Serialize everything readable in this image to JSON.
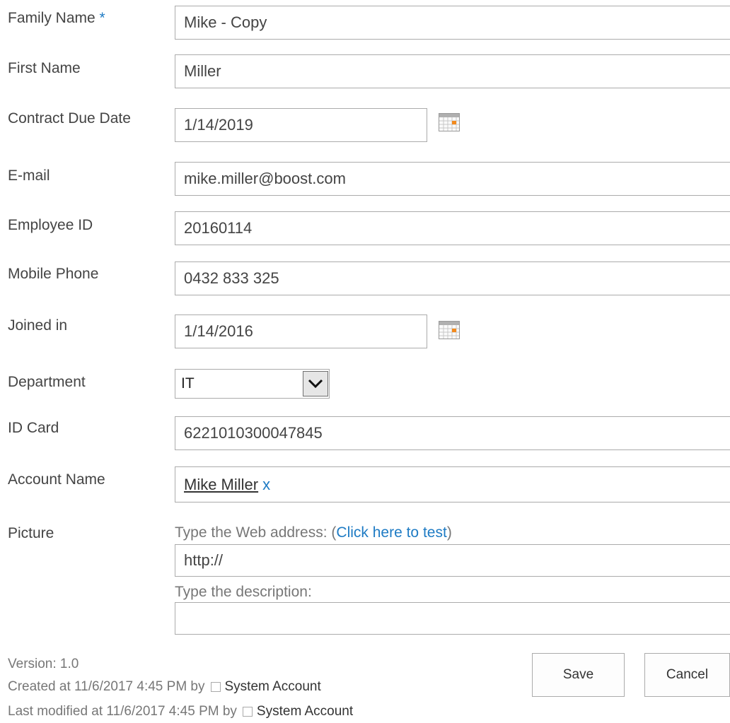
{
  "form": {
    "family_name": {
      "label": "Family Name",
      "required_marker": "*",
      "value": "Mike - Copy"
    },
    "first_name": {
      "label": "First Name",
      "value": "Miller"
    },
    "contract_due_date": {
      "label": "Contract Due Date",
      "value": "1/14/2019"
    },
    "email": {
      "label": "E-mail",
      "value": "mike.miller@boost.com"
    },
    "employee_id": {
      "label": "Employee ID",
      "value": "20160114"
    },
    "mobile_phone": {
      "label": "Mobile Phone",
      "value": "0432 833 325"
    },
    "joined_in": {
      "label": "Joined in",
      "value": "1/14/2016"
    },
    "department": {
      "label": "Department",
      "selected": "IT"
    },
    "id_card": {
      "label": "ID Card",
      "value": "6221010300047845"
    },
    "account_name": {
      "label": "Account Name",
      "person": "Mike Miller",
      "remove": "x"
    },
    "picture": {
      "label": "Picture",
      "address_prompt_before": "Type the Web address: (",
      "test_link": "Click here to test",
      "address_prompt_after": ")",
      "address_value": "http://",
      "description_prompt": "Type the description:",
      "description_value": ""
    }
  },
  "footer": {
    "version": "Version: 1.0",
    "created": "Created at 11/6/2017 4:45 PM  by",
    "created_by": "System Account",
    "modified": "Last modified at 11/6/2017 4:45 PM  by",
    "modified_by": "System Account"
  },
  "buttons": {
    "save": "Save",
    "cancel": "Cancel"
  },
  "icons": {
    "calendar": "calendar-icon",
    "dropdown": "chevron-down-icon",
    "presence": "presence-checkbox-icon"
  }
}
